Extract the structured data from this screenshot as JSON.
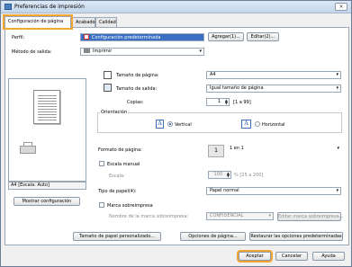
{
  "window": {
    "title": "Preferencias de impresión",
    "close_glyph": "×"
  },
  "tabs": [
    {
      "label": "Configuración de página"
    },
    {
      "label": "Acabado"
    },
    {
      "label": "Calidad"
    }
  ],
  "profile": {
    "label": "Perfil:",
    "value": "Configuración predeterminada",
    "add_button": "Agregar(1)...",
    "edit_button": "Editar(2)..."
  },
  "output": {
    "label": "Método de salida:",
    "value": "Imprimir"
  },
  "page_size": {
    "label": "Tamaño de página:",
    "value": "A4"
  },
  "output_size": {
    "label": "Tamaño de salida:",
    "value": "Igual tamaño de página"
  },
  "copies": {
    "label": "Copias:",
    "value": "1",
    "range": "[1 a 99]"
  },
  "orientation": {
    "label": "Orientación",
    "portrait": "Vertical",
    "landscape": "Horizontal",
    "selected": "portrait"
  },
  "page_layout": {
    "label": "Formato de página:",
    "value": "1 en 1",
    "icon_text": "1"
  },
  "manual_scaling": {
    "label": "Escala manual",
    "checked": false,
    "scale_label": "Escala:",
    "scale_value": "100",
    "scale_range": "% [25 a 200]"
  },
  "paper_type": {
    "label": "Tipo de papel(4):",
    "value": "Papel normal"
  },
  "watermark": {
    "label": "Marca sobreimpresa",
    "checked": false,
    "name_label": "Nombre de la marca sobreimpresa:",
    "name_value": "CONFIDENCIAL",
    "edit_button": "Editar marca sobreimpresa..."
  },
  "preview": {
    "status": "A4 [Escala: Auto]",
    "show_settings_button": "Mostrar configuración"
  },
  "buttons": {
    "custom_size": "Tamaño de papel personalizado...",
    "page_options": "Opciones de página...",
    "restore_defaults": "Restaurar las opciones predeterminadas",
    "ok": "Aceptar",
    "cancel": "Cancelar",
    "help": "Ayuda"
  },
  "colors": {
    "highlight": "#f2a531",
    "selection": "#3a6fc4"
  }
}
